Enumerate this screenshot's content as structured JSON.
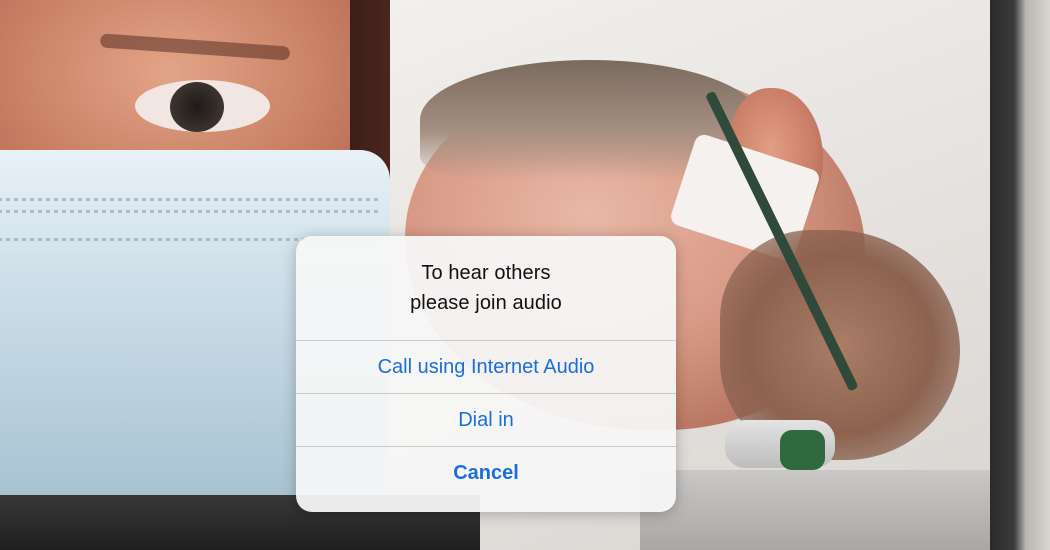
{
  "dialog": {
    "title_line_1": "To hear others",
    "title_line_2": "please join audio",
    "buttons": {
      "internet_audio": "Call using Internet Audio",
      "dial_in": "Dial in",
      "cancel": "Cancel"
    }
  },
  "colors": {
    "action_blue": "#1a6fd6",
    "dialog_background": "#f7f7f7"
  }
}
